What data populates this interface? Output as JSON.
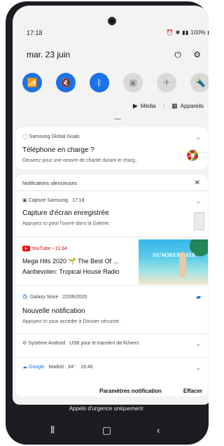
{
  "status_bar": {
    "time": "17:18",
    "icons_text": "⏰ ✱ ◢ ▮ 100%",
    "battery": "100%"
  },
  "header": {
    "date": "mar. 23 juin"
  },
  "quick_settings": {
    "tiles": [
      {
        "name": "wifi",
        "glyph": "◠",
        "state": "on"
      },
      {
        "name": "sound",
        "glyph": "🔇",
        "state": "on"
      },
      {
        "name": "bluetooth",
        "glyph": "ᛒ",
        "state": "on"
      },
      {
        "name": "lock",
        "glyph": "▣",
        "state": "off"
      },
      {
        "name": "airplane",
        "glyph": "✈",
        "state": "off"
      },
      {
        "name": "flashlight",
        "glyph": "♅",
        "state": "off"
      }
    ]
  },
  "media_row": {
    "media_label": "Média",
    "devices_label": "Appareils"
  },
  "card_goals": {
    "app": "Samsung Global Goals",
    "title": "Téléphone en charge ?",
    "body": "Oeuvrez pour une oeuvre de charité durant le charg.."
  },
  "silent": {
    "section_label": "Notifications silencieuses",
    "capture": {
      "app": "Capture Samsung",
      "time": "17:18",
      "title": "Capture d'écran enregistrée",
      "body": "Appuyez ici pour l'ouvrir dans la Galerie."
    },
    "youtube": {
      "app": "YouTube",
      "time": "11:34",
      "title": "Mega Hits 2020 🌱 The Best Of ...",
      "subtitle": "Aanbevolen: Tropical House Radio",
      "thumb_text": "SUMMER MIX"
    },
    "galaxy": {
      "app": "Galaxy Store",
      "time": "22/06/2020",
      "title": "Nouvelle notification",
      "body": "Appuyez ici pour accéder à Dossier sécurisé."
    },
    "android": {
      "app": "Système Android",
      "text": "USB pour le transfert de fichiers"
    },
    "google": {
      "app": "Google",
      "text": "Madrid : 34°",
      "time": "16:46"
    }
  },
  "footer": {
    "settings": "Paramètres notification",
    "clear": "Effacer"
  },
  "lockscreen": {
    "emergency": "Appels d'urgence uniquement"
  },
  "colors": {
    "accent": "#1a73e8",
    "youtube_red": "#ff0000"
  }
}
